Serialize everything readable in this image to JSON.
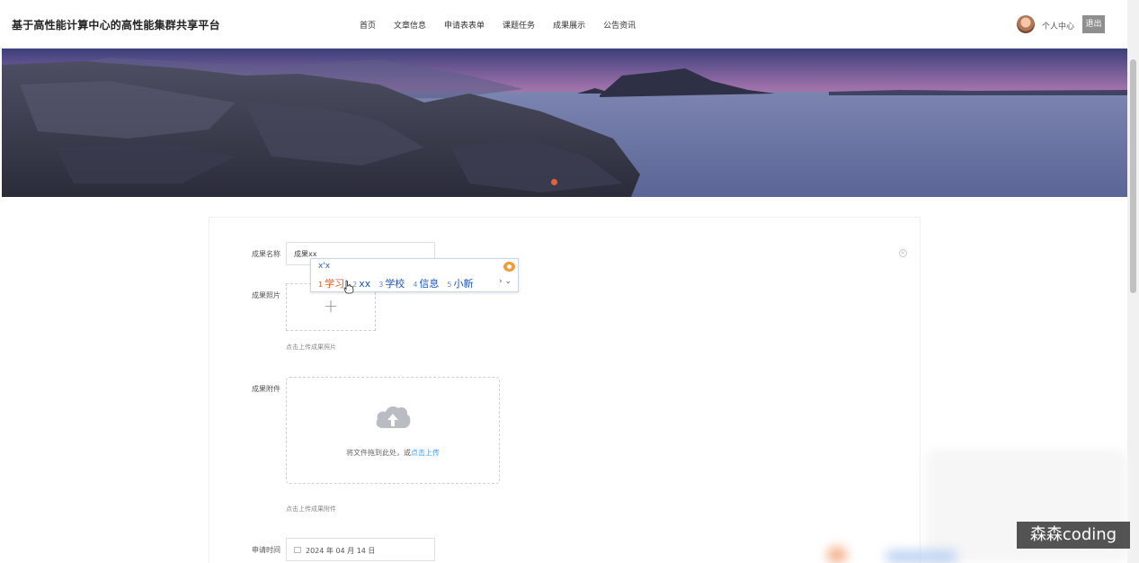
{
  "header": {
    "site_title": "基于高性能计算中心的高性能集群共享平台",
    "nav": [
      "首页",
      "文章信息",
      "申请表表单",
      "课题任务",
      "成果展示",
      "公告资讯"
    ],
    "user_center": "个人中心",
    "logout": "退出"
  },
  "banner": {
    "active_dot_color": "#e8603a"
  },
  "form": {
    "result_name": {
      "label": "成果名称",
      "value": "成果xx"
    },
    "result_photo": {
      "label": "成果照片",
      "hint": "点击上传成果照片"
    },
    "result_attachment": {
      "label": "成果附件",
      "drag_text": "将文件拖到此处，或",
      "click_upload": "点击上传",
      "hint": "点击上传成果附件"
    },
    "apply_time": {
      "label": "申请时间",
      "value": "2024 年 04 月 14 日"
    }
  },
  "ime": {
    "composition": "x'x",
    "candidates": [
      {
        "num": "1",
        "text": "学习"
      },
      {
        "num": "2",
        "text": "xx"
      },
      {
        "num": "3",
        "text": "学校"
      },
      {
        "num": "4",
        "text": "信息"
      },
      {
        "num": "5",
        "text": "小新"
      }
    ],
    "arrows": "› ⌄"
  },
  "watermark": "森森coding"
}
